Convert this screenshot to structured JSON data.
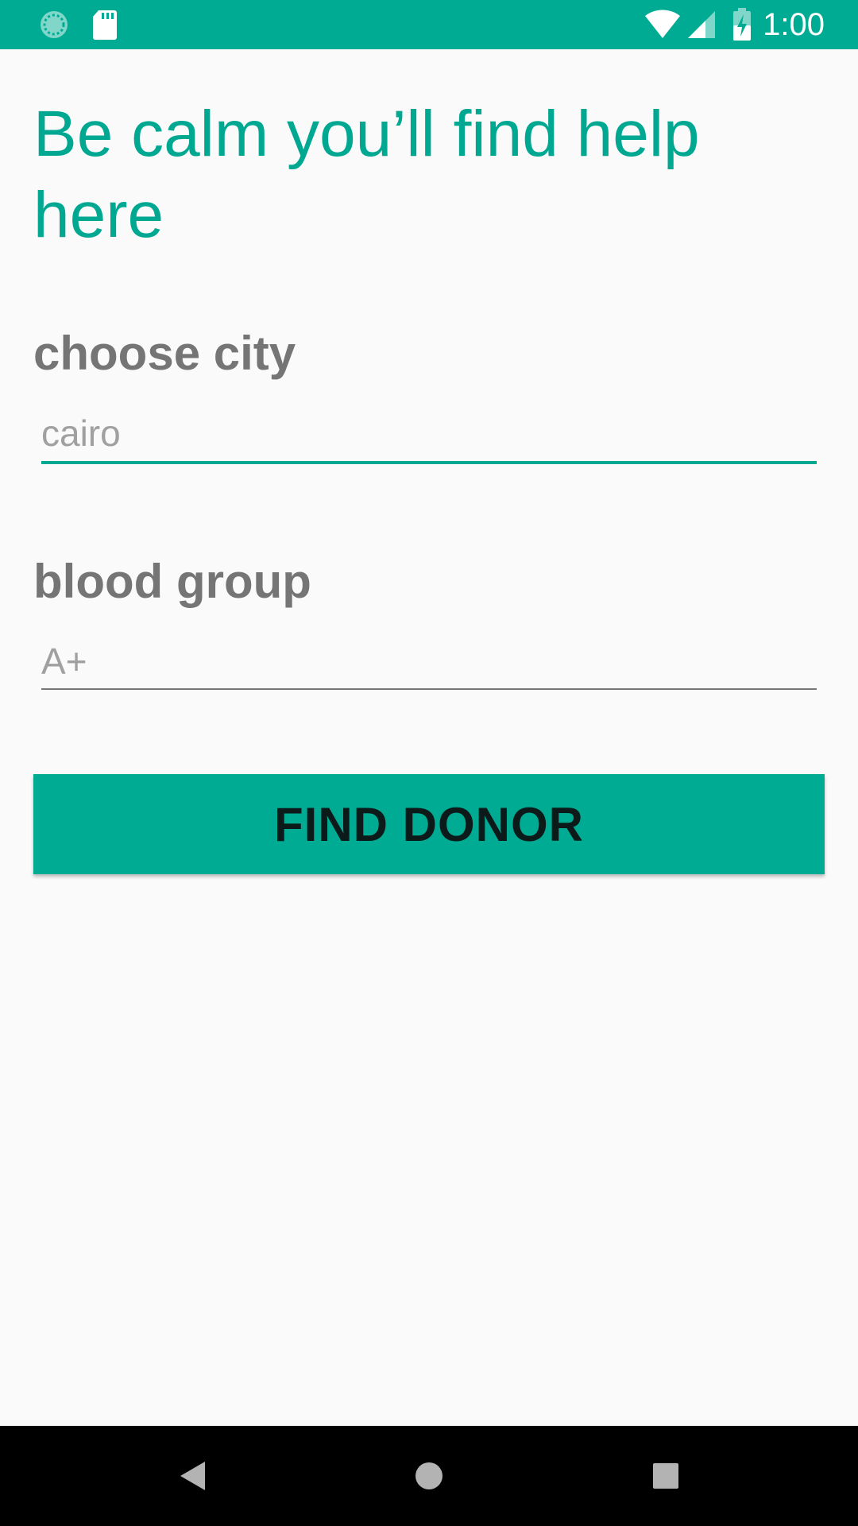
{
  "status_bar": {
    "time": "1:00",
    "background": "#00ab94",
    "left_icons": [
      "loading-circle-icon",
      "sd-card-icon"
    ],
    "right_icons": [
      "wifi-icon",
      "cell-signal-icon",
      "battery-charging-icon"
    ]
  },
  "main": {
    "headline": "Be calm you’ll find help here",
    "city": {
      "label": "choose city",
      "placeholder": "cairo",
      "value": ""
    },
    "blood_group": {
      "label": "blood group",
      "placeholder": "A+",
      "value": ""
    },
    "find_button_label": "FIND DONOR"
  },
  "nav_bar": {
    "icons": [
      "back-icon",
      "home-icon",
      "recents-icon"
    ]
  },
  "colors": {
    "accent": "#00ab94",
    "label_gray": "#757575",
    "background": "#fafafa"
  }
}
